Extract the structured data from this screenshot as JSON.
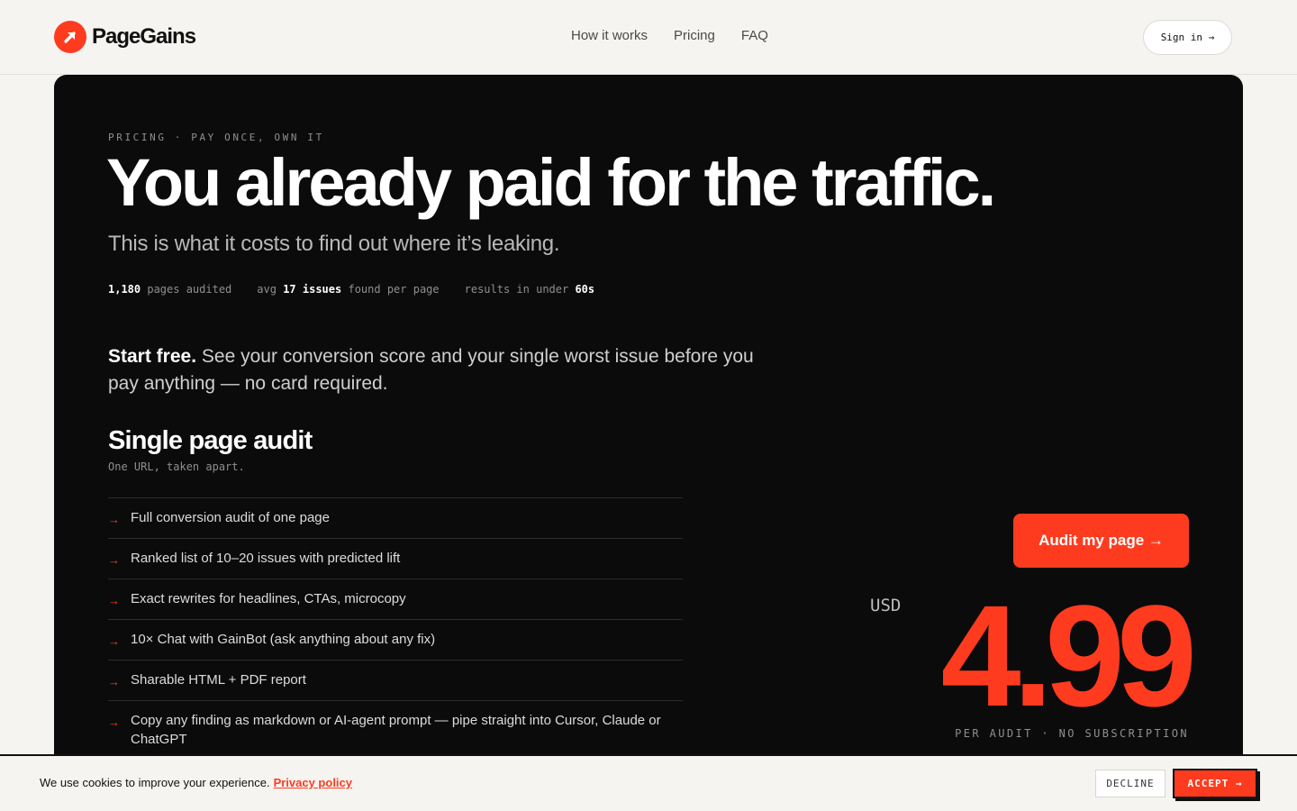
{
  "header": {
    "brand_name": "PageGains",
    "brand_icon": "arrow-up-right-icon",
    "nav": [
      "How it works",
      "Pricing",
      "FAQ"
    ],
    "signin_label": "Sign in →"
  },
  "hero": {
    "eyebrow": "PRICING · PAY ONCE, OWN IT",
    "headline": "You already paid for the traffic.",
    "subhead": "This is what it costs to find out where it’s leaking.",
    "stats": [
      {
        "prefix": "",
        "value": "1,180",
        "suffix": "pages audited"
      },
      {
        "prefix": "avg",
        "value": "17 issues",
        "suffix": "found per page"
      },
      {
        "prefix": "results in under",
        "value": "60s",
        "suffix": ""
      }
    ]
  },
  "intro": {
    "lead": "Start free.",
    "body": "See your conversion score and your single worst issue before you pay anything — no card required."
  },
  "plan": {
    "title": "Single page audit",
    "subtitle": "One URL, taken apart.",
    "features": [
      "Full conversion audit of one page",
      "Ranked list of 10–20 issues with predicted lift",
      "Exact rewrites for headlines, CTAs, microcopy",
      "10× Chat with GainBot (ask anything about any fix)",
      "Sharable HTML + PDF report",
      "Copy any finding as markdown or AI-agent prompt — pipe straight into Cursor, Claude or ChatGPT"
    ],
    "feature_marker": "→",
    "cta_label": "Audit my page →",
    "currency": "USD",
    "price": "4.99",
    "price_note": "PER AUDIT · NO SUBSCRIPTION"
  },
  "cookie": {
    "message": "We use cookies to improve your experience.",
    "policy_link": "Privacy policy",
    "decline_label": "DECLINE",
    "accept_label": "ACCEPT →"
  },
  "colors": {
    "accent": "#ff3b1f",
    "card_bg": "#0b0b0b",
    "page_bg": "#f5f4f0"
  }
}
